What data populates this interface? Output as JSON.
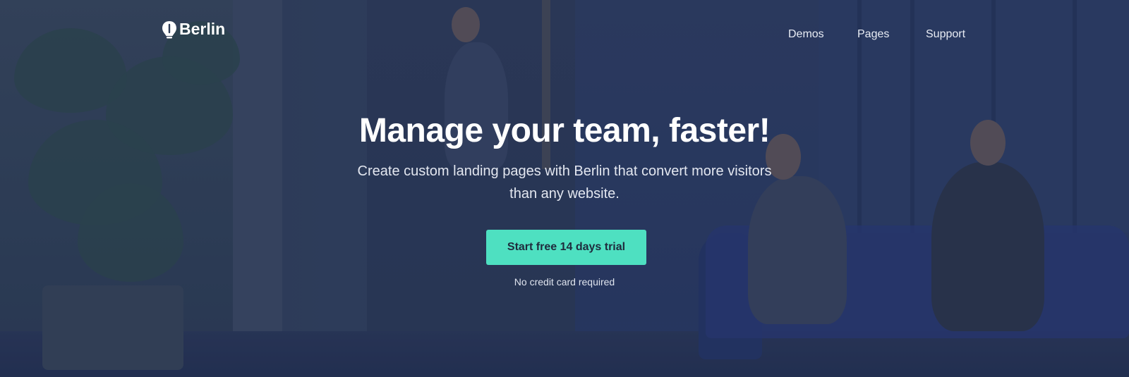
{
  "brand": {
    "name": "Berlin",
    "logo_icon": "bulb-icon"
  },
  "nav": {
    "items": [
      {
        "label": "Demos"
      },
      {
        "label": "Pages"
      },
      {
        "label": "Support"
      }
    ]
  },
  "hero": {
    "headline": "Manage your team, faster!",
    "subtitle": "Create custom landing pages with Berlin that convert more visitors than any website.",
    "cta_label": "Start free 14 days trial",
    "note": "No credit card required"
  },
  "colors": {
    "accent": "#4EE0C1",
    "overlay": "#233052",
    "text": "#FFFFFF"
  }
}
